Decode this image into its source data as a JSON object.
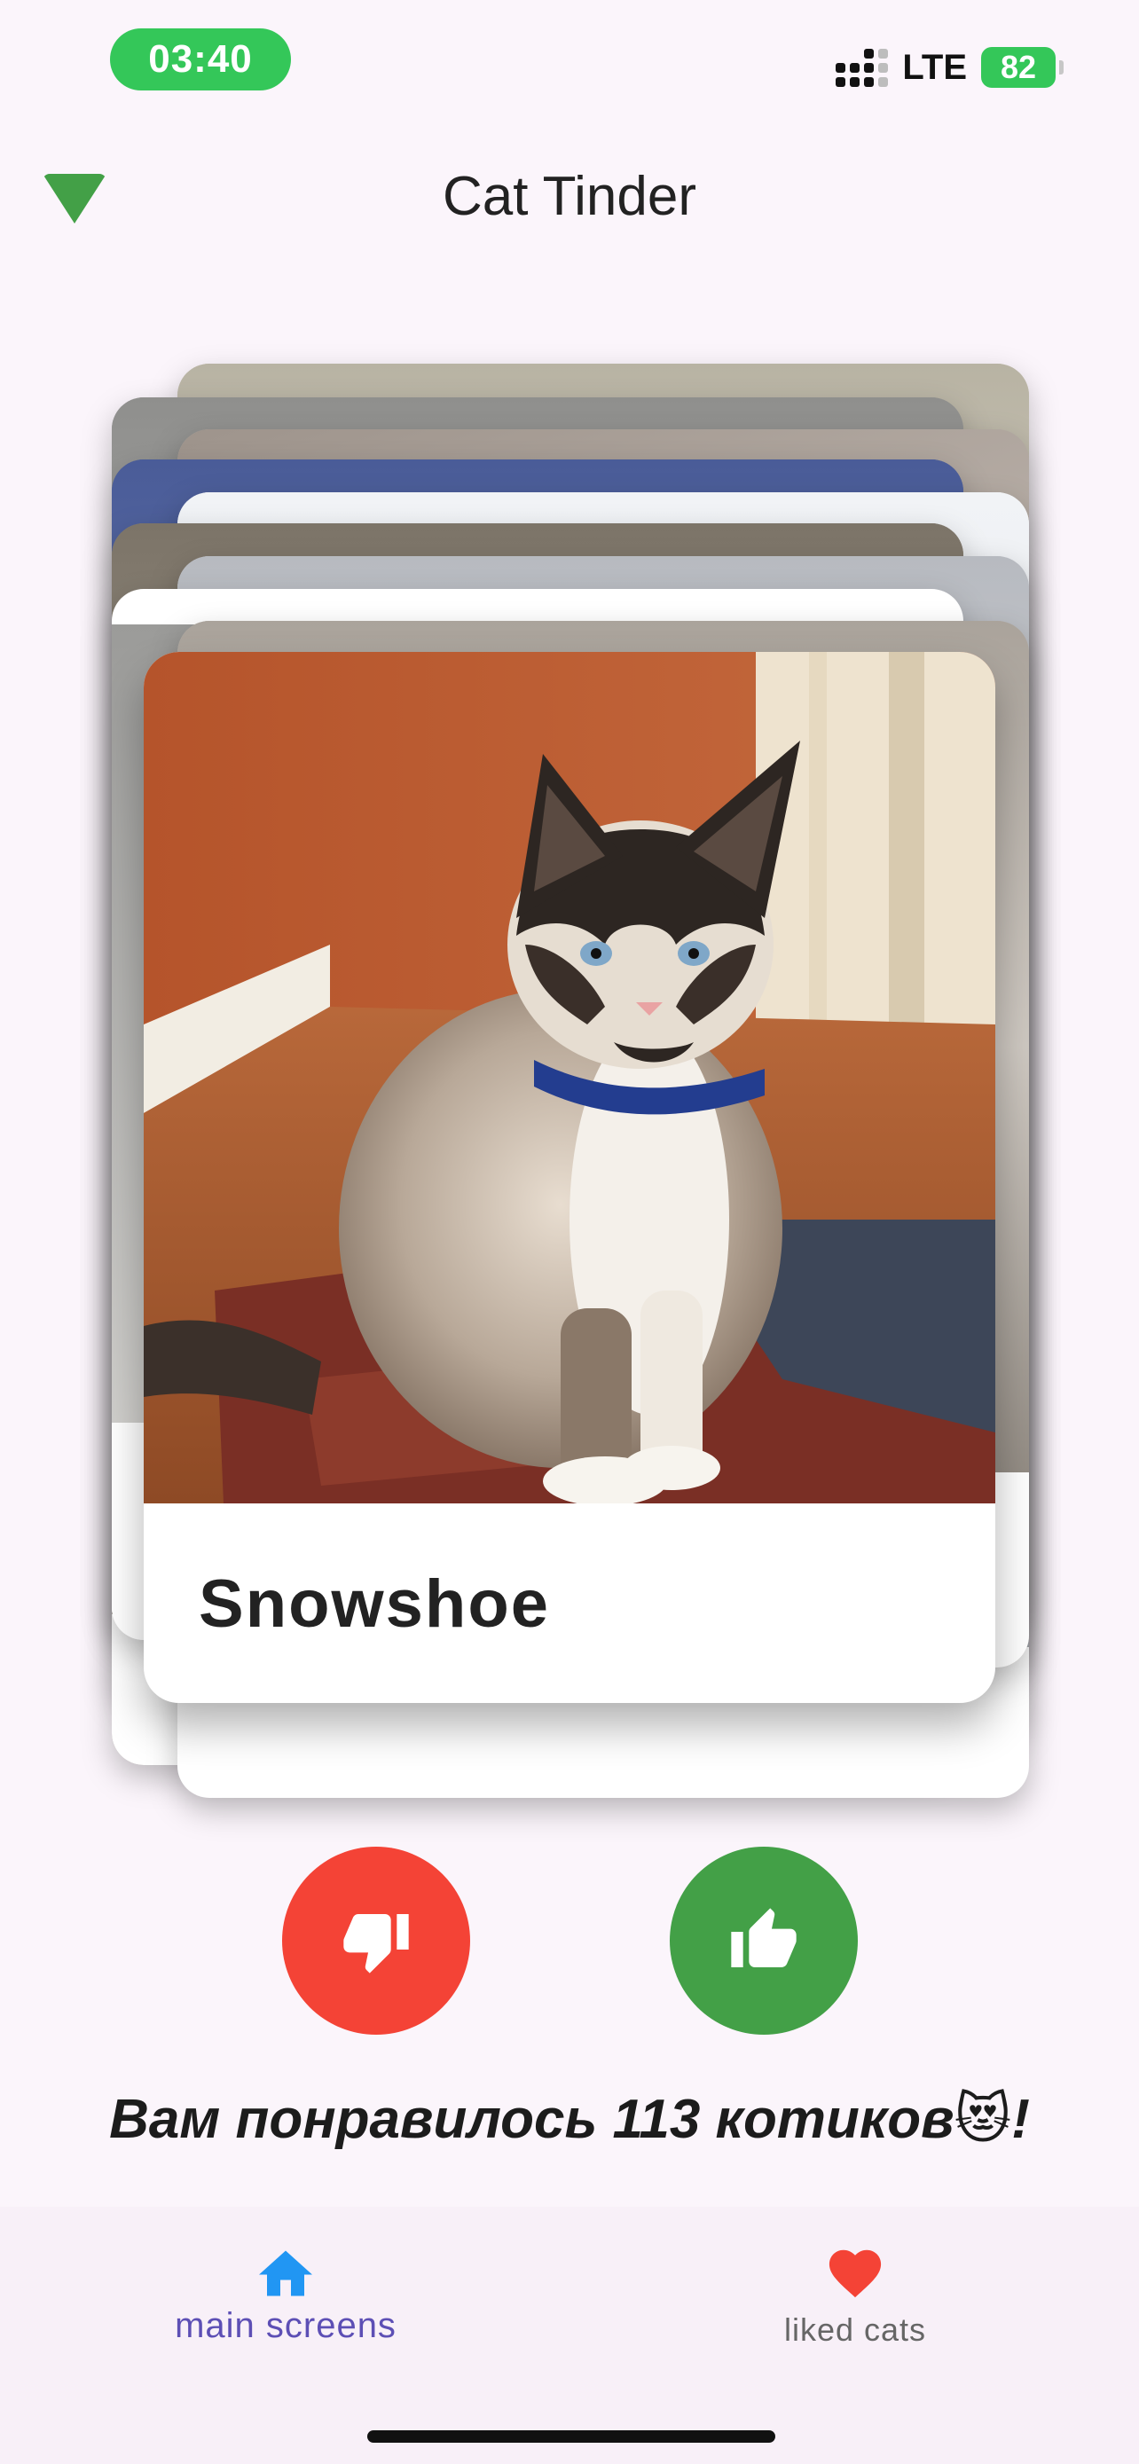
{
  "status_bar": {
    "time": "03:40",
    "network": "LTE",
    "battery": "82"
  },
  "header": {
    "title": "Cat Tinder",
    "connection_icon": "wifi-icon",
    "connection_color": "#43a047"
  },
  "card": {
    "breed": "Snowshoe"
  },
  "actions": {
    "dislike_icon": "thumb-down-icon",
    "like_icon": "thumb-up-icon",
    "dislike_color": "#f44336",
    "like_color": "#43a047"
  },
  "liked_text": "Вам понравилось 113 котиков😻!",
  "bottom_nav": {
    "items": [
      {
        "label": "main screens",
        "icon": "home-icon",
        "active": true,
        "color": "#2196f3"
      },
      {
        "label": "liked cats",
        "icon": "heart-icon",
        "active": false,
        "color": "#f44336"
      }
    ]
  }
}
